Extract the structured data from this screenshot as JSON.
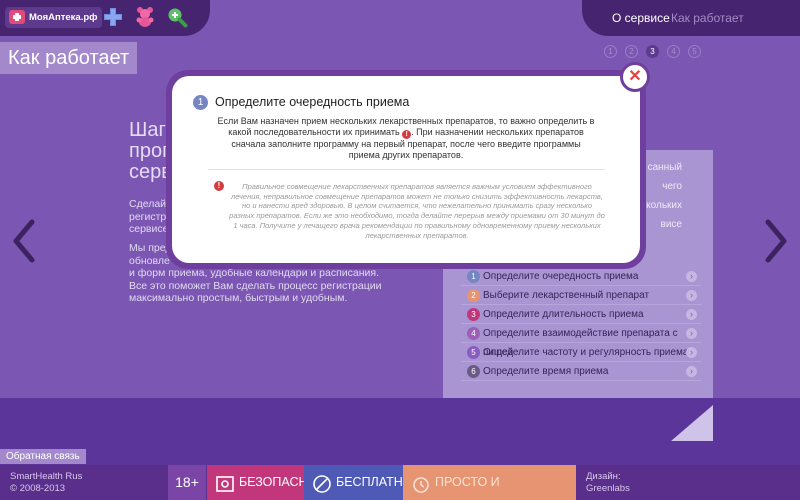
{
  "header": {
    "logo_text": "МояАптека.рф",
    "nav": [
      {
        "label": "О сервисе"
      },
      {
        "label": "Как работает"
      }
    ],
    "icons": [
      "medical-cross-icon",
      "teddy-bear-icon",
      "search-plus-icon"
    ]
  },
  "page": {
    "title": "Как работает",
    "pager": [
      "1",
      "2",
      "3",
      "4",
      "5"
    ],
    "active_step": 3
  },
  "background": {
    "heading_lines": [
      "Шаг",
      "прог",
      "серви"
    ],
    "text1_lines": [
      "Сделай",
      "регистр",
      "сервисе"
    ],
    "text2_lines": [
      "Мы пред",
      "обновле",
      "и форм приема, удобные календари и расписания.",
      "Все это поможет Вам сделать процесс регистрации",
      "максимально простым, быстрым и удобным."
    ],
    "card_under_lines": [
      "санный",
      "чего",
      "ескольких",
      "висе"
    ]
  },
  "steps": [
    {
      "num": "1",
      "label": "Определите очередность приема",
      "color": "#7486c3"
    },
    {
      "num": "2",
      "label": "Выберите лекарственный препарат",
      "color": "#e69472"
    },
    {
      "num": "3",
      "label": "Определите длительность приема",
      "color": "#c2367c"
    },
    {
      "num": "4",
      "label": "Определите взаимодействие препарата с пищей",
      "color": "#9b5fb8"
    },
    {
      "num": "5",
      "label": "Определите частоту и регулярность приема",
      "color": "#8a5bc1"
    },
    {
      "num": "6",
      "label": "Определите время приема",
      "color": "#6a5a8a"
    }
  ],
  "modal": {
    "step_num": "1",
    "title": "Определите очередность приема",
    "text_part1": "Если Вам назначен прием нескольких лекарственных препаратов, то важно определить в какой последовательности их принимать",
    "text_part2": ". При назначении нескольких препаратов сначала заполните программу на первый препарат, после чего введите программы приема других препаратов.",
    "close_symbol": "✕",
    "warn_symbol": "!",
    "note": "Правильное совмещение лекарственных препаратов является важным условием эффективного лечения, неправильное совмещение препаратов может не только снизить эффективность лекарств, но и нанести вред здоровью. В целом считается, что нежелательно принимать сразу несколько разных препаратов. Если же это необходимо, тогда делайте перерыв между приемами от 30 минут до 1 часа. Получите у лечащего врача рекомендации по правильному одновременному приему нескольких лекарственных препаратов."
  },
  "footer": {
    "feedback": "Обратная связь",
    "copyright_lines": [
      "SmartHealth Rus",
      "© 2008-2013"
    ],
    "age": "18+",
    "tags": [
      {
        "label": "БЕЗОПАСНО",
        "icon": "safe-icon"
      },
      {
        "label": "БЕСПЛАТНО",
        "icon": "no-money-icon"
      },
      {
        "label": "ПРОСТО И ЭФФЕКТИВНО",
        "icon": "clock-icon"
      }
    ],
    "design_lines": [
      "Дизайн:",
      "Greenlabs"
    ]
  }
}
